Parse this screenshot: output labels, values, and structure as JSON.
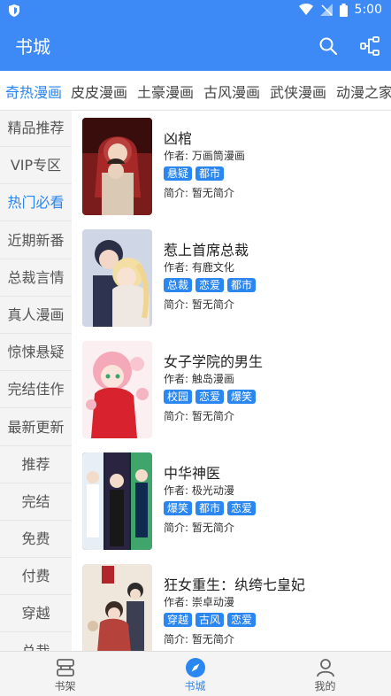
{
  "status_bar": {
    "time": "5:00"
  },
  "app_bar": {
    "title": "书城"
  },
  "category_tabs": [
    "奇热漫画",
    "皮皮漫画",
    "土豪漫画",
    "古风漫画",
    "武侠漫画",
    "动漫之家"
  ],
  "active_tab": "奇热漫画",
  "sidebar": [
    "精品推荐",
    "VIP专区",
    "热门必看",
    "近期新番",
    "总裁言情",
    "真人漫画",
    "惊悚悬疑",
    "完结佳作",
    "最新更新",
    "推荐",
    "完结",
    "免费",
    "付费",
    "穿越",
    "总裁"
  ],
  "active_sidebar": "热门必看",
  "comics": [
    {
      "title": "凶棺",
      "author": "作者: 万画筒漫画",
      "tags": [
        "悬疑",
        "都市"
      ],
      "intro": "简介: 暂无简介"
    },
    {
      "title": "惹上首席总裁",
      "author": "作者: 有鹿文化",
      "tags": [
        "总裁",
        "恋爱",
        "都市"
      ],
      "intro": "简介: 暂无简介"
    },
    {
      "title": "女子学院的男生",
      "author": "作者: 触岛漫画",
      "tags": [
        "校园",
        "恋爱",
        "爆笑"
      ],
      "intro": "简介: 暂无简介"
    },
    {
      "title": "中华神医",
      "author": "作者: 极光动漫",
      "tags": [
        "爆笑",
        "都市",
        "恋爱"
      ],
      "intro": "简介: 暂无简介"
    },
    {
      "title": "狂女重生：纨绔七皇妃",
      "author": "作者: 崇卓动漫",
      "tags": [
        "穿越",
        "古风",
        "恋爱"
      ],
      "intro": "简介: 暂无简介"
    }
  ],
  "bottom_nav": [
    {
      "label": "书架"
    },
    {
      "label": "书城"
    },
    {
      "label": "我的"
    }
  ],
  "colors": {
    "primary": "#3d8af7",
    "accent": "#2a86f0",
    "tag_bg": "#2a86f0"
  }
}
